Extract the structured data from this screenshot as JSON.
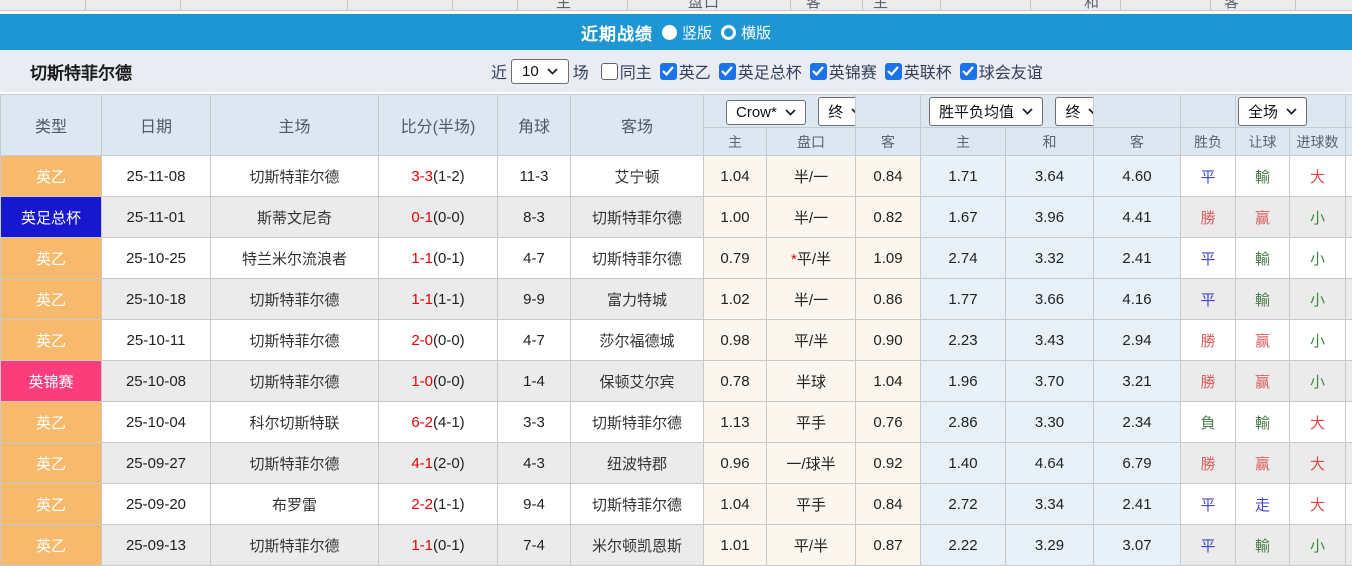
{
  "top_strip": {
    "labels": [
      "主",
      "盘口",
      "客",
      "主",
      "和",
      "客"
    ]
  },
  "banner": {
    "title": "近期战绩",
    "options": [
      {
        "label": "竖版",
        "selected": true
      },
      {
        "label": "横版",
        "selected": false
      }
    ]
  },
  "filter": {
    "team": "切斯特菲尔德",
    "recent_label": "近",
    "recent_value": "10",
    "matches_label": "场",
    "same_home": {
      "label": "同主",
      "checked": false
    },
    "leagues": [
      {
        "label": "英乙",
        "checked": true
      },
      {
        "label": "英足总杯",
        "checked": true
      },
      {
        "label": "英锦赛",
        "checked": true
      },
      {
        "label": "英联杯",
        "checked": true
      },
      {
        "label": "球会友谊",
        "checked": true
      }
    ]
  },
  "table": {
    "headers": {
      "type": "类型",
      "date": "日期",
      "home": "主场",
      "score": "比分(半场)",
      "corners": "角球",
      "away": "客场"
    },
    "selects": {
      "odds_company": "Crow*",
      "odds_final": "终",
      "wdl_mean": "胜平负均值",
      "wdl_final": "终",
      "period": "全场"
    },
    "sub_headers": [
      "主",
      "盘口",
      "客",
      "主",
      "和",
      "客",
      "胜负",
      "让球",
      "进球数"
    ],
    "rows": [
      {
        "type": "英乙",
        "type_bg": "#f7ba6c",
        "date": "25-11-08",
        "home": "切斯特菲尔德",
        "home_is_team": true,
        "score_ft": "3-3",
        "score_ht": "(1-2)",
        "corners": "11-3",
        "away": "艾宁顿",
        "away_is_team": false,
        "odds_home": "1.04",
        "handicap": "半/一",
        "handicap_star": false,
        "odds_away": "0.84",
        "mean_win": "1.71",
        "mean_draw": "3.64",
        "mean_lose": "4.60",
        "result": "平",
        "result_type": "draw",
        "handicap_result": "輸",
        "handicap_result_type": "lose",
        "goals": "大",
        "goals_type": "big"
      },
      {
        "type": "英足总杯",
        "type_bg": "#1617ce",
        "date": "25-11-01",
        "home": "斯蒂文尼奇",
        "home_is_team": false,
        "score_ft": "0-1",
        "score_ht": "(0-0)",
        "corners": "8-3",
        "away": "切斯特菲尔德",
        "away_is_team": true,
        "odds_home": "1.00",
        "handicap": "半/一",
        "handicap_star": false,
        "odds_away": "0.82",
        "mean_win": "1.67",
        "mean_draw": "3.96",
        "mean_lose": "4.41",
        "result": "勝",
        "result_type": "win",
        "handicap_result": "赢",
        "handicap_result_type": "win",
        "goals": "小",
        "goals_type": "small"
      },
      {
        "type": "英乙",
        "type_bg": "#f7ba6c",
        "date": "25-10-25",
        "home": "特兰米尔流浪者",
        "home_is_team": false,
        "score_ft": "1-1",
        "score_ht": "(0-1)",
        "corners": "4-7",
        "away": "切斯特菲尔德",
        "away_is_team": true,
        "odds_home": "0.79",
        "handicap": "平/半",
        "handicap_star": true,
        "odds_away": "1.09",
        "mean_win": "2.74",
        "mean_draw": "3.32",
        "mean_lose": "2.41",
        "result": "平",
        "result_type": "draw",
        "handicap_result": "輸",
        "handicap_result_type": "lose",
        "goals": "小",
        "goals_type": "small"
      },
      {
        "type": "英乙",
        "type_bg": "#f7ba6c",
        "date": "25-10-18",
        "home": "切斯特菲尔德",
        "home_is_team": true,
        "score_ft": "1-1",
        "score_ht": "(1-1)",
        "corners": "9-9",
        "away": "富力特城",
        "away_is_team": false,
        "odds_home": "1.02",
        "handicap": "半/一",
        "handicap_star": false,
        "odds_away": "0.86",
        "mean_win": "1.77",
        "mean_draw": "3.66",
        "mean_lose": "4.16",
        "result": "平",
        "result_type": "draw",
        "handicap_result": "輸",
        "handicap_result_type": "lose",
        "goals": "小",
        "goals_type": "small"
      },
      {
        "type": "英乙",
        "type_bg": "#f7ba6c",
        "date": "25-10-11",
        "home": "切斯特菲尔德",
        "home_is_team": true,
        "score_ft": "2-0",
        "score_ht": "(0-0)",
        "corners": "4-7",
        "away": "莎尔福德城",
        "away_is_team": false,
        "odds_home": "0.98",
        "handicap": "平/半",
        "handicap_star": false,
        "odds_away": "0.90",
        "mean_win": "2.23",
        "mean_draw": "3.43",
        "mean_lose": "2.94",
        "result": "勝",
        "result_type": "win",
        "handicap_result": "赢",
        "handicap_result_type": "win",
        "goals": "小",
        "goals_type": "small"
      },
      {
        "type": "英锦赛",
        "type_bg": "#fb3d7c",
        "date": "25-10-08",
        "home": "切斯特菲尔德",
        "home_is_team": true,
        "score_ft": "1-0",
        "score_ht": "(0-0)",
        "corners": "1-4",
        "away": "保顿艾尔宾",
        "away_is_team": false,
        "odds_home": "0.78",
        "handicap": "半球",
        "handicap_star": false,
        "odds_away": "1.04",
        "mean_win": "1.96",
        "mean_draw": "3.70",
        "mean_lose": "3.21",
        "result": "勝",
        "result_type": "win",
        "handicap_result": "赢",
        "handicap_result_type": "win",
        "goals": "小",
        "goals_type": "small"
      },
      {
        "type": "英乙",
        "type_bg": "#f7ba6c",
        "date": "25-10-04",
        "home": "科尔切斯特联",
        "home_is_team": false,
        "score_ft": "6-2",
        "score_ht": "(4-1)",
        "corners": "3-3",
        "away": "切斯特菲尔德",
        "away_is_team": true,
        "odds_home": "1.13",
        "handicap": "平手",
        "handicap_star": false,
        "odds_away": "0.76",
        "mean_win": "2.86",
        "mean_draw": "3.30",
        "mean_lose": "2.34",
        "result": "負",
        "result_type": "lose",
        "handicap_result": "輸",
        "handicap_result_type": "lose",
        "goals": "大",
        "goals_type": "big"
      },
      {
        "type": "英乙",
        "type_bg": "#f7ba6c",
        "date": "25-09-27",
        "home": "切斯特菲尔德",
        "home_is_team": true,
        "score_ft": "4-1",
        "score_ht": "(2-0)",
        "corners": "4-3",
        "away": "纽波特郡",
        "away_is_team": false,
        "odds_home": "0.96",
        "handicap": "一/球半",
        "handicap_star": false,
        "odds_away": "0.92",
        "mean_win": "1.40",
        "mean_draw": "4.64",
        "mean_lose": "6.79",
        "result": "勝",
        "result_type": "win",
        "handicap_result": "赢",
        "handicap_result_type": "win",
        "goals": "大",
        "goals_type": "big"
      },
      {
        "type": "英乙",
        "type_bg": "#f7ba6c",
        "date": "25-09-20",
        "home": "布罗雷",
        "home_is_team": false,
        "score_ft": "2-2",
        "score_ht": "(1-1)",
        "corners": "9-4",
        "away": "切斯特菲尔德",
        "away_is_team": true,
        "odds_home": "1.04",
        "handicap": "平手",
        "handicap_star": false,
        "odds_away": "0.84",
        "mean_win": "2.72",
        "mean_draw": "3.34",
        "mean_lose": "2.41",
        "result": "平",
        "result_type": "draw",
        "handicap_result": "走",
        "handicap_result_type": "draw",
        "goals": "大",
        "goals_type": "big"
      },
      {
        "type": "英乙",
        "type_bg": "#f7ba6c",
        "date": "25-09-13",
        "home": "切斯特菲尔德",
        "home_is_team": true,
        "score_ft": "1-1",
        "score_ht": "(0-1)",
        "corners": "7-4",
        "away": "米尔顿凯恩斯",
        "away_is_team": false,
        "odds_home": "1.01",
        "handicap": "平/半",
        "handicap_star": false,
        "odds_away": "0.87",
        "mean_win": "2.22",
        "mean_draw": "3.29",
        "mean_lose": "3.07",
        "result": "平",
        "result_type": "draw",
        "handicap_result": "輸",
        "handicap_result_type": "lose",
        "goals": "小",
        "goals_type": "small"
      }
    ]
  },
  "colors": {
    "banner_blue": "#1d96d3",
    "league_l2_orange": "#f7ba6c",
    "league_fa_cup_blue": "#1617ce",
    "league_trophy_pink": "#fb3d7c",
    "team_green": "#3a8a3a",
    "score_red": "#e60000",
    "win_red": "#dd5f5f",
    "draw_blue": "#4343cd",
    "lose_green": "#4e7d4e",
    "big_red": "#e04848",
    "small_green": "#3d8b3d",
    "checkbox_blue": "#1b73e9"
  }
}
